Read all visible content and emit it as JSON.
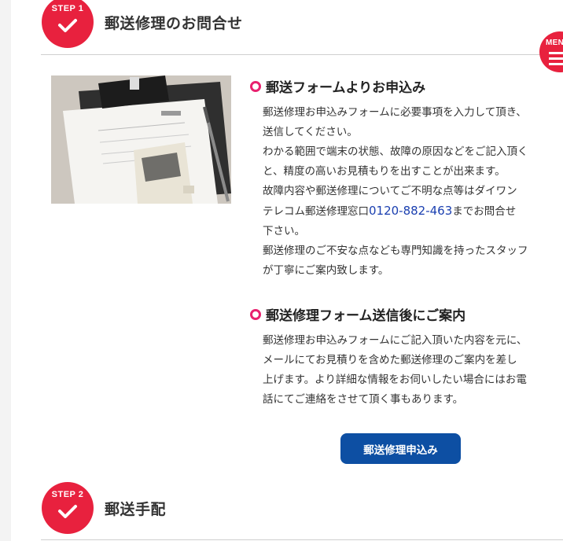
{
  "step1": {
    "label": "STEP 1",
    "title": "郵送修理のお問合せ"
  },
  "menu": {
    "label": "MENU"
  },
  "form_section": {
    "heading": "郵送フォームよりお申込み",
    "lines": [
      "郵送修理お申込みフォームに必要事項を入力して頂き、",
      "送信してください。",
      "わかる範囲で端末の状態、故障の原因などをご記入頂く",
      "と、精度の高いお見積もりを出すことが出来ます。",
      "故障内容や郵送修理についてご不明な点等はダイワン"
    ],
    "tel_prefix": "テレコム郵送修理窓口",
    "tel_number": "0120-882-463",
    "tel_suffix": "までお問合せ",
    "lines_after": [
      "下さい。",
      "郵送修理のご不安な点なども専門知識を持ったスタッフ",
      "が丁寧にご案内致します。"
    ]
  },
  "after_section": {
    "heading": "郵送修理フォーム送信後にご案内",
    "lines": [
      "郵送修理お申込みフォームにご記入頂いた内容を元に、",
      "メールにてお見積りを含めた郵送修理のご案内を差し",
      "上げます。より詳細な情報をお伺いしたい場合にはお電",
      "話にてご連絡をさせて頂く事もあります。"
    ]
  },
  "apply_button": {
    "label": "郵送修理申込み"
  },
  "step2": {
    "label": "STEP 2",
    "title": "郵送手配"
  },
  "colors": {
    "accent": "#e8213e",
    "bullet": "#e8216e",
    "button": "#0d4fa3",
    "link": "#1a3fb0"
  }
}
